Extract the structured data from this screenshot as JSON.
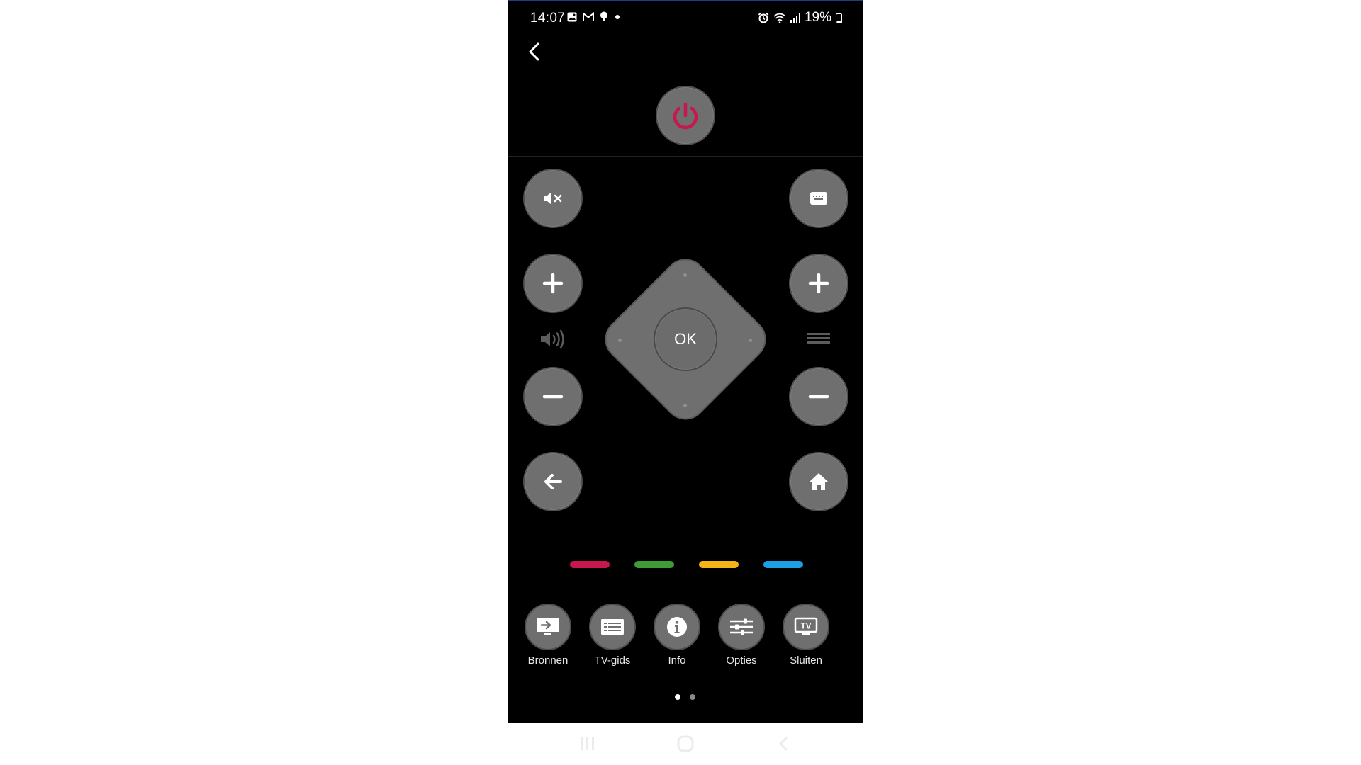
{
  "status_bar": {
    "time": "14:07",
    "battery": "19%",
    "icons": [
      "image-icon",
      "gmail-icon",
      "bulb-icon",
      "dot-icon",
      "alarm-icon",
      "wifi-icon",
      "signal-icon",
      "battery-icon"
    ]
  },
  "header": {
    "back_icon": "chevron-left-icon"
  },
  "power": {
    "icon": "power-icon",
    "color": "#c8174e"
  },
  "left_column": {
    "mute_icon": "mute-icon",
    "volume_up_icon": "plus-icon",
    "volume_label_icon": "speaker-icon",
    "volume_down_icon": "minus-icon",
    "back_icon": "arrow-left-icon"
  },
  "right_column": {
    "keyboard_icon": "keyboard-icon",
    "channel_up_icon": "plus-icon",
    "channel_label_icon": "channel-lines-icon",
    "channel_down_icon": "minus-icon",
    "home_icon": "home-icon"
  },
  "dpad": {
    "ok_label": "OK"
  },
  "color_buttons": [
    {
      "name": "red",
      "color": "#c8174e"
    },
    {
      "name": "green",
      "color": "#3f9b35"
    },
    {
      "name": "yellow",
      "color": "#f2b417"
    },
    {
      "name": "blue",
      "color": "#1aa0e3"
    }
  ],
  "function_buttons": [
    {
      "label": "Bronnen",
      "icon": "sources-icon"
    },
    {
      "label": "TV-gids",
      "icon": "tv-guide-icon"
    },
    {
      "label": "Info",
      "icon": "info-icon"
    },
    {
      "label": "Opties",
      "icon": "options-icon"
    },
    {
      "label": "Sluiten",
      "icon": "tv-icon",
      "icon_text": "TV"
    }
  ],
  "pager": {
    "pages": 2,
    "current": 1,
    "active_color": "#ffffff",
    "inactive_color": "#8a8a8a"
  },
  "navbar_icons": [
    "recents-icon",
    "home-circle-icon",
    "back-nav-icon"
  ]
}
